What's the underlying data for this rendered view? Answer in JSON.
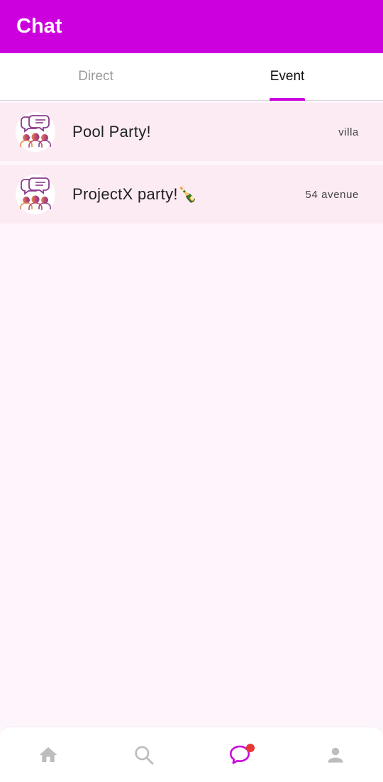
{
  "appbar": {
    "title": "Chat"
  },
  "tabs": [
    {
      "label": "Direct",
      "active": false
    },
    {
      "label": "Event",
      "active": true
    }
  ],
  "chats": [
    {
      "name": "Pool Party!",
      "location": "villa",
      "avatar_icon": "group-chat-icon"
    },
    {
      "name": "ProjectX party!🍾",
      "location": "54 avenue",
      "avatar_icon": "group-chat-icon"
    }
  ],
  "bottom_nav": [
    {
      "icon": "home-icon",
      "active": false
    },
    {
      "icon": "search-icon",
      "active": false
    },
    {
      "icon": "chat-bubble-icon",
      "active": true,
      "badge": true
    },
    {
      "icon": "profile-icon",
      "active": false
    }
  ],
  "colors": {
    "primary": "#cc00dd",
    "row_bg": "#fcebf3",
    "page_bg": "#fdf5fb",
    "badge": "#e53935",
    "inactive_icon": "#bdbdbd"
  }
}
